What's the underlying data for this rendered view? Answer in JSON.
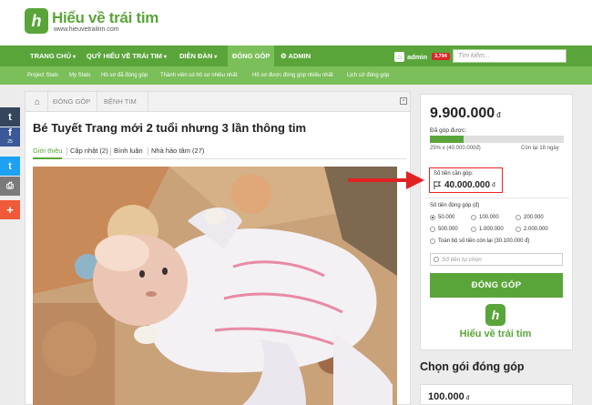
{
  "header": {
    "logo_name": "Hiểu về trái tim",
    "logo_url": "www.hieuvetraitim.com",
    "logo_mark": "h"
  },
  "nav": {
    "items": [
      {
        "label": "TRANG CHỦ",
        "caret": "▾"
      },
      {
        "label": "QUỸ HIỂU VỀ TRÁI TIM",
        "caret": "▾"
      },
      {
        "label": "DIỄN ĐÀN",
        "caret": "▾"
      },
      {
        "label": "ĐÓNG GÓP",
        "caret": ""
      },
      {
        "label": "ADMIN",
        "icon": "gear-icon"
      }
    ],
    "user": "admin",
    "user_badge": "3,794",
    "search_placeholder": "Tìm kiếm..."
  },
  "subnav": {
    "items": [
      "Project Stats",
      "My Stats",
      "Hồ sơ đã đóng góp",
      "Thành viên có hồ sơ nhiều nhất",
      "Hồ sơ được đóng góp nhiều nhất",
      "Lịch sử đóng góp"
    ]
  },
  "social": {
    "buttons": [
      {
        "name": "tumblr-icon",
        "glyph": "t",
        "color": "#35465c",
        "count": ""
      },
      {
        "name": "facebook-icon",
        "glyph": "f",
        "color": "#3b5998",
        "count": "25"
      },
      {
        "name": "twitter-icon",
        "glyph": "t",
        "color": "#1da1f2",
        "count": ""
      },
      {
        "name": "print-icon",
        "glyph": "⎙",
        "color": "#7a7a7a",
        "count": ""
      },
      {
        "name": "more-icon",
        "glyph": "+",
        "color": "#ee5a3a",
        "count": ""
      }
    ]
  },
  "breadcrumb": {
    "items": [
      "ĐÓNG GÓP",
      "BỆNH TIM"
    ]
  },
  "article": {
    "title": "Bé Tuyết Trang mới 2 tuổi nhưng 3 lần thông tim",
    "tabs": [
      "Giới thiệu",
      "Cập nhật (2)",
      "Bình luận",
      "Nhà hảo tâm (27)"
    ],
    "active_tab": 0
  },
  "donation": {
    "total": "9.900.000",
    "currency": "đ",
    "raised_label": "Đã góp được:",
    "progress_fraction": 0.25,
    "progress_left": "25% x (40.000.000đ)",
    "progress_right": "Còn lại 18 ngày",
    "goal_label": "Số tiền cần góp:",
    "goal_value": "40.000.000",
    "pick_label": "Số tiền đóng góp (đ)",
    "options": [
      "50.000",
      "100.000",
      "200.000",
      "500.000",
      "1.000.000",
      "2.000.000"
    ],
    "selected_option": 0,
    "full_option": "Toàn bộ số tiền còn lại (30.100.000 đ)",
    "custom_placeholder": "Số tiền tự chọn",
    "donate_label": "ĐÓNG GÓP",
    "brand_name": "Hiểu về trái tim"
  },
  "packages": {
    "title": "Chọn gói đóng góp",
    "first_price": "100.000",
    "currency": "đ"
  },
  "colors": {
    "brand_green": "#5aa53a",
    "light_green": "#7bbf5a",
    "alert_red": "#e22222"
  }
}
